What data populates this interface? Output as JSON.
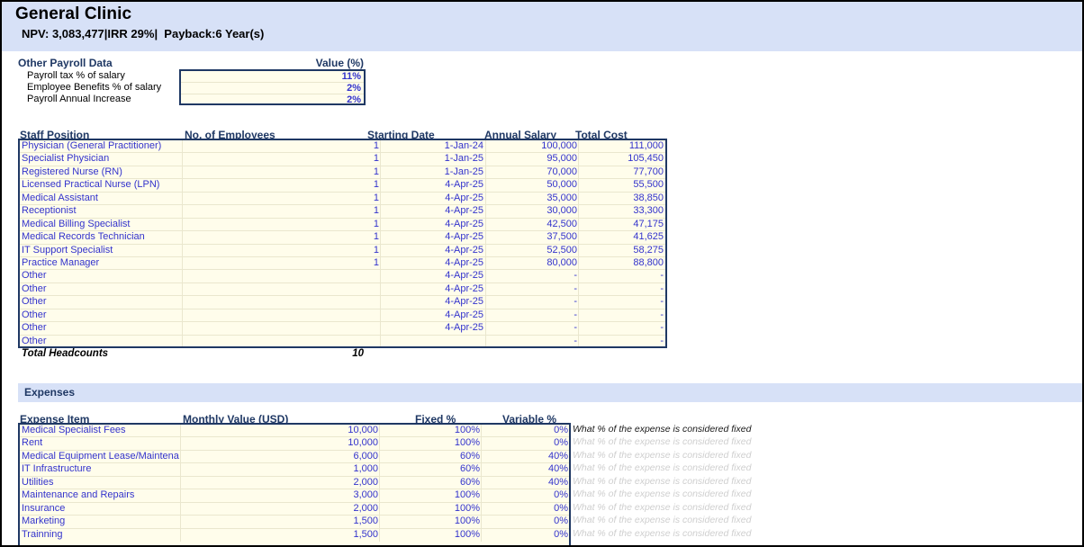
{
  "banner": {
    "title": "General Clinic",
    "subtitle": "NPV: 3,083,477|IRR 29%|  Payback:6 Year(s)"
  },
  "payroll": {
    "section_title": "Other Payroll Data",
    "value_header": "Value (%)",
    "rows": [
      {
        "label": "Payroll tax % of salary",
        "value": "11%"
      },
      {
        "label": "Employee Benefits % of salary",
        "value": "2%"
      },
      {
        "label": "Payroll Annual Increase",
        "value": "2%"
      }
    ]
  },
  "staff": {
    "headers": {
      "position": "Staff Position",
      "employees": "No. of Employees",
      "start_date": "Starting Date",
      "annual_salary": "Annual Salary",
      "total_cost": "Total Cost"
    },
    "rows": [
      {
        "position": "Physician (General Practitioner)",
        "employees": "1",
        "start_date": "1-Jan-24",
        "annual_salary": "100,000",
        "total_cost": "111,000"
      },
      {
        "position": "Specialist Physician",
        "employees": "1",
        "start_date": "1-Jan-25",
        "annual_salary": "95,000",
        "total_cost": "105,450"
      },
      {
        "position": "Registered Nurse (RN)",
        "employees": "1",
        "start_date": "1-Jan-25",
        "annual_salary": "70,000",
        "total_cost": "77,700"
      },
      {
        "position": "Licensed Practical Nurse (LPN)",
        "employees": "1",
        "start_date": "4-Apr-25",
        "annual_salary": "50,000",
        "total_cost": "55,500"
      },
      {
        "position": "Medical Assistant",
        "employees": "1",
        "start_date": "4-Apr-25",
        "annual_salary": "35,000",
        "total_cost": "38,850"
      },
      {
        "position": "Receptionist",
        "employees": "1",
        "start_date": "4-Apr-25",
        "annual_salary": "30,000",
        "total_cost": "33,300"
      },
      {
        "position": "Medical Billing Specialist",
        "employees": "1",
        "start_date": "4-Apr-25",
        "annual_salary": "42,500",
        "total_cost": "47,175"
      },
      {
        "position": "Medical Records Technician",
        "employees": "1",
        "start_date": "4-Apr-25",
        "annual_salary": "37,500",
        "total_cost": "41,625"
      },
      {
        "position": "IT Support Specialist",
        "employees": "1",
        "start_date": "4-Apr-25",
        "annual_salary": "52,500",
        "total_cost": "58,275"
      },
      {
        "position": "Practice Manager",
        "employees": "1",
        "start_date": "4-Apr-25",
        "annual_salary": "80,000",
        "total_cost": "88,800"
      },
      {
        "position": "Other",
        "employees": "",
        "start_date": "4-Apr-25",
        "annual_salary": "-",
        "total_cost": "-"
      },
      {
        "position": "Other",
        "employees": "",
        "start_date": "4-Apr-25",
        "annual_salary": "-",
        "total_cost": "-"
      },
      {
        "position": "Other",
        "employees": "",
        "start_date": "4-Apr-25",
        "annual_salary": "-",
        "total_cost": "-"
      },
      {
        "position": "Other",
        "employees": "",
        "start_date": "4-Apr-25",
        "annual_salary": "-",
        "total_cost": "-"
      },
      {
        "position": "Other",
        "employees": "",
        "start_date": "4-Apr-25",
        "annual_salary": "-",
        "total_cost": "-"
      },
      {
        "position": "Other",
        "employees": "",
        "start_date": "",
        "annual_salary": "-",
        "total_cost": "-"
      }
    ],
    "total_label": "Total Headcounts",
    "total_value": "10"
  },
  "expenses": {
    "section_title": "Expenses",
    "headers": {
      "item": "Expense Item",
      "monthly_value": "Monthly Value (USD)",
      "fixed_pct": "Fixed %",
      "variable_pct": "Variable  %"
    },
    "comment_text": "What % of the expense is considered fixed",
    "rows": [
      {
        "item": "Medical Specialist Fees",
        "monthly_value": "10,000",
        "fixed_pct": "100%",
        "variable_pct": "0%"
      },
      {
        "item": "Rent",
        "monthly_value": "10,000",
        "fixed_pct": "100%",
        "variable_pct": "0%"
      },
      {
        "item": "Medical Equipment Lease/Maintenance",
        "monthly_value": "6,000",
        "fixed_pct": "60%",
        "variable_pct": "40%"
      },
      {
        "item": "IT Infrastructure",
        "monthly_value": "1,000",
        "fixed_pct": "60%",
        "variable_pct": "40%"
      },
      {
        "item": "Utilities",
        "monthly_value": "2,000",
        "fixed_pct": "60%",
        "variable_pct": "40%"
      },
      {
        "item": "Maintenance and Repairs",
        "monthly_value": "3,000",
        "fixed_pct": "100%",
        "variable_pct": "0%"
      },
      {
        "item": "Insurance",
        "monthly_value": "2,000",
        "fixed_pct": "100%",
        "variable_pct": "0%"
      },
      {
        "item": "Marketing",
        "monthly_value": "1,500",
        "fixed_pct": "100%",
        "variable_pct": "0%"
      },
      {
        "item": "Trainning",
        "monthly_value": "1,500",
        "fixed_pct": "100%",
        "variable_pct": "0%"
      }
    ]
  },
  "colors": {
    "banner_blue": "#d7e1f7",
    "cell_cream": "#fffdeb",
    "value_blue": "#3333cc",
    "header_navy": "#1f3864",
    "grid_line": "#eae7ce"
  }
}
